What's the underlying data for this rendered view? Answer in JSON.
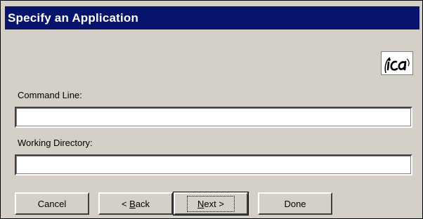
{
  "dialog": {
    "title": "Specify an Application",
    "logo_icon": "ica-logo-icon"
  },
  "fields": {
    "command_line": {
      "label": "Command Line:",
      "value": ""
    },
    "working_directory": {
      "label": "Working Directory:",
      "value": ""
    }
  },
  "buttons": {
    "cancel": "Cancel",
    "back_prefix": "< ",
    "back_accel": "B",
    "back_suffix": "ack",
    "next_accel": "N",
    "next_suffix": "ext >",
    "done": "Done"
  },
  "colors": {
    "titlebar": "#08136b",
    "face": "#d4d0c8"
  }
}
